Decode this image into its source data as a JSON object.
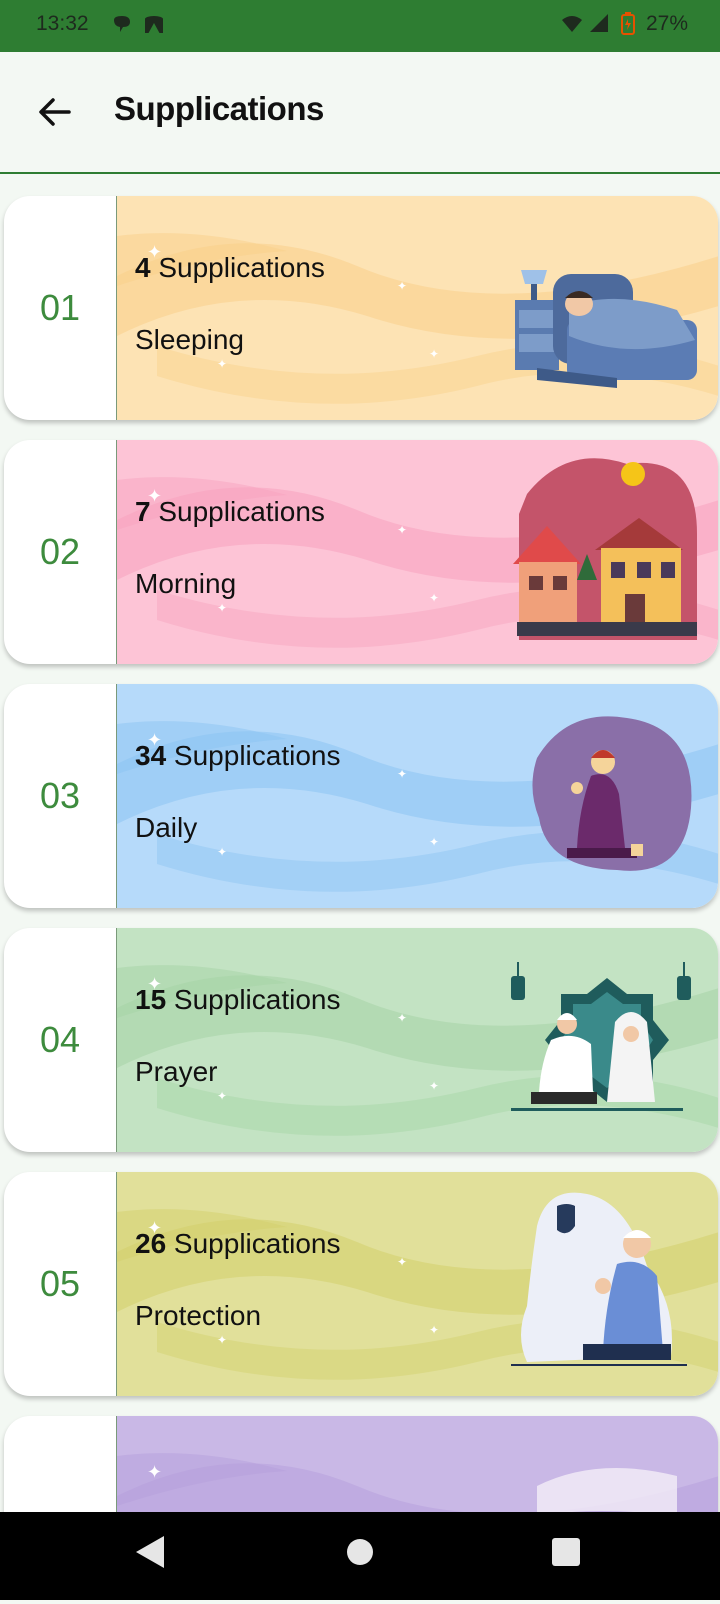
{
  "status": {
    "time": "13:32",
    "battery": "27%"
  },
  "appbar": {
    "title": "Supplications"
  },
  "categories": [
    {
      "number": "01",
      "count": "4",
      "unit": " Supplications",
      "name": "Sleeping",
      "color": "#fde3b4",
      "wave": "#f9d08a",
      "art": "sleeping-illustration"
    },
    {
      "number": "02",
      "count": "7",
      "unit": " Supplications",
      "name": "Morning",
      "color": "#fdc4d6",
      "wave": "#f7a3bf",
      "art": "morning-houses-illustration"
    },
    {
      "number": "03",
      "count": "34",
      "unit": " Supplications",
      "name": "Daily",
      "color": "#b6dafa",
      "wave": "#8cc4f2",
      "art": "praying-man-illustration"
    },
    {
      "number": "04",
      "count": "15",
      "unit": " Supplications",
      "name": "Prayer",
      "color": "#c3e3c3",
      "wave": "#a5d4a5",
      "art": "mosque-couple-illustration"
    },
    {
      "number": "05",
      "count": "26",
      "unit": " Supplications",
      "name": "Protection",
      "color": "#e1e09a",
      "wave": "#d3d06c",
      "art": "protection-shield-illustration"
    },
    {
      "number": "",
      "count": "",
      "unit": "",
      "name": "",
      "color": "#c9b8e6",
      "wave": "#b6a0dc",
      "art": ""
    }
  ]
}
